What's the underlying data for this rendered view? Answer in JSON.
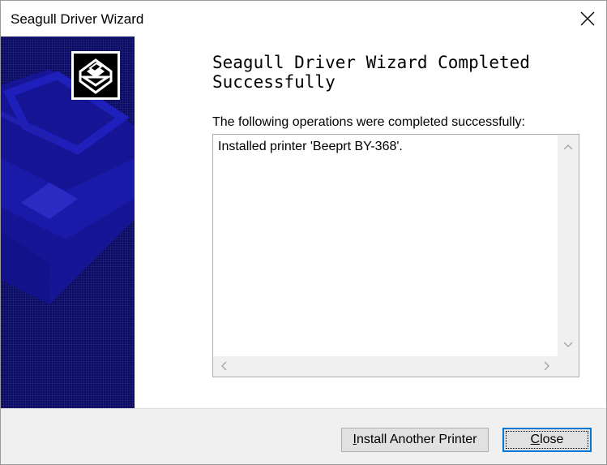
{
  "window": {
    "title": "Seagull Driver Wizard"
  },
  "headline": {
    "line1": "Seagull Driver Wizard Completed",
    "line2": "Successfully"
  },
  "operations": {
    "label": "The following operations were completed successfully:",
    "log_text": "Installed printer 'Beeprt BY-368'."
  },
  "buttons": {
    "install_another": {
      "mnemonic": "I",
      "rest": "nstall Another Printer"
    },
    "close": {
      "mnemonic": "C",
      "rest": "lose"
    }
  },
  "icons": {
    "close": "close-icon",
    "logo": "printer-logo-icon",
    "scroll_up": "chevron-up-icon",
    "scroll_down": "chevron-down-icon",
    "scroll_left": "chevron-left-icon",
    "scroll_right": "chevron-right-icon"
  },
  "colors": {
    "banner": "#0b0b66",
    "banner_printer": "#1a1aa8",
    "focus_border": "#0078d7",
    "footer": "#f0f0f0"
  }
}
